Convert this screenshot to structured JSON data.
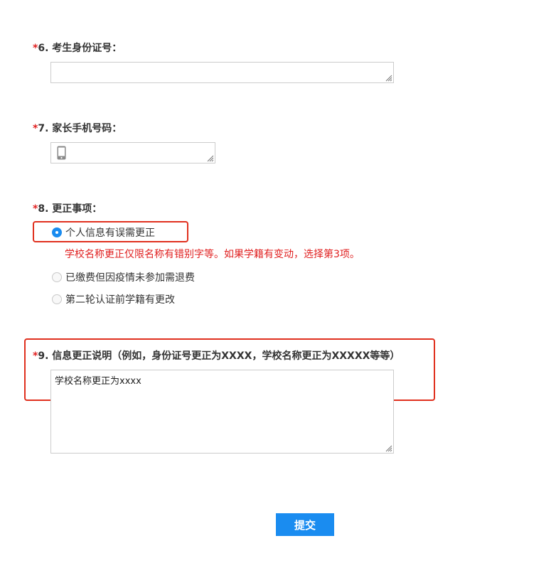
{
  "questions": {
    "q6": {
      "required_mark": "*",
      "number": "6.",
      "title": "考生身份证号：",
      "value": ""
    },
    "q7": {
      "required_mark": "*",
      "number": "7.",
      "title": "家长手机号码：",
      "value": "",
      "icon": "mobile-phone-icon"
    },
    "q8": {
      "required_mark": "*",
      "number": "8.",
      "title": "更正事项：",
      "options": [
        {
          "label": "个人信息有误需更正",
          "selected": true
        },
        {
          "label": "已缴费但因疫情未参加需退费",
          "selected": false
        },
        {
          "label": "第二轮认证前学籍有更改",
          "selected": false
        }
      ],
      "hint": "学校名称更正仅限名称有错别字等。如果学籍有变动，选择第3项。"
    },
    "q9": {
      "required_mark": "*",
      "number": "9.",
      "title": "信息更正说明（例如，身份证号更正为XXXX，学校名称更正为XXXXX等等）",
      "value": "学校名称更正为xxxx"
    }
  },
  "submit_label": "提交",
  "colors": {
    "accent": "#1a8cf0",
    "required": "#e02020",
    "highlight_border": "#e0301e",
    "text": "#333333",
    "border": "#cccccc"
  }
}
